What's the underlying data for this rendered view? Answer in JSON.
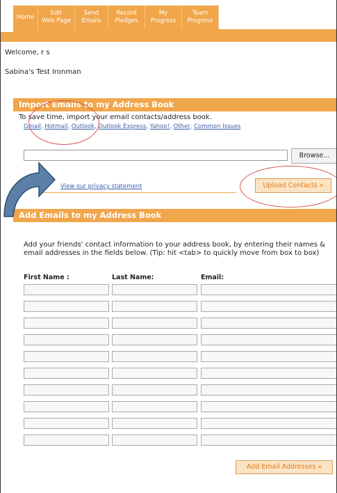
{
  "nav": {
    "tabs": [
      {
        "label": "Home"
      },
      {
        "label": "Edit\nWeb Page"
      },
      {
        "label": "Send\nEmails"
      },
      {
        "label": "Record\nPledges"
      },
      {
        "label": "My\nProgress"
      },
      {
        "label": "Team\nProgress"
      }
    ]
  },
  "welcome": "Welcome, r s",
  "event_name": "Sabina's Test Ironman",
  "import_section": {
    "title": "Import Emails to my Address Book",
    "description": "To save time, import your email contacts/address book.",
    "links": [
      "Gmail",
      "Hotmail",
      "Outlook",
      "Outlook Express",
      "Yahoo!",
      "Other",
      "Common Issues"
    ],
    "browse_label": "Browse...",
    "privacy_label": "View our privacy statement",
    "upload_label": "Upload Contacts »"
  },
  "add_section": {
    "title": "Add Emails to my Address Book",
    "instructions": "Add your friends' contact information to your address book, by entering their names & email addresses in the fields below. (Tip: hit <tab> to quickly move from box to box)",
    "columns": [
      "First Name :",
      "Last Name:",
      "Email:"
    ],
    "row_count": 10,
    "submit_label": "Add Email Addresses »"
  },
  "colors": {
    "accent": "#f0a64a",
    "link": "#3b5fa8",
    "button_text": "#e07a1a",
    "annotation": "#d9534f",
    "arrow": "#5b7fa6"
  }
}
